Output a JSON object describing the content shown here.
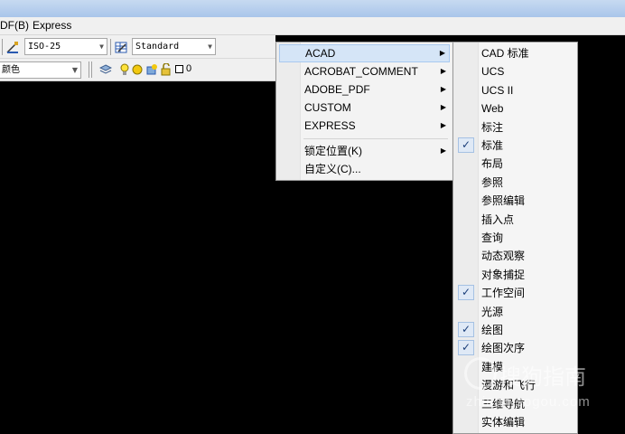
{
  "menubar": {
    "items": [
      "DF(B)",
      "Express"
    ]
  },
  "toolbar": {
    "dim_style": "ISO-25",
    "table_style": "Standard",
    "color_combo": "颜色",
    "layer_name": "0"
  },
  "menu1": {
    "items": [
      {
        "label": "ACAD",
        "submenu": true,
        "highlighted": true
      },
      {
        "label": "ACROBAT_COMMENT",
        "submenu": true
      },
      {
        "label": "ADOBE_PDF",
        "submenu": true
      },
      {
        "label": "CUSTOM",
        "submenu": true
      },
      {
        "label": "EXPRESS",
        "submenu": true
      },
      {
        "label": "锁定位置(K)",
        "submenu": true
      },
      {
        "label": "自定义(C)...",
        "submenu": false
      }
    ]
  },
  "menu2": {
    "items": [
      {
        "label": "CAD 标准",
        "checked": false
      },
      {
        "label": "UCS",
        "checked": false
      },
      {
        "label": "UCS II",
        "checked": false
      },
      {
        "label": "Web",
        "checked": false
      },
      {
        "label": "标注",
        "checked": false
      },
      {
        "label": "标准",
        "checked": true
      },
      {
        "label": "布局",
        "checked": false
      },
      {
        "label": "参照",
        "checked": false
      },
      {
        "label": "参照编辑",
        "checked": false
      },
      {
        "label": "插入点",
        "checked": false
      },
      {
        "label": "查询",
        "checked": false
      },
      {
        "label": "动态观察",
        "checked": false
      },
      {
        "label": "对象捕捉",
        "checked": false
      },
      {
        "label": "工作空间",
        "checked": true
      },
      {
        "label": "光源",
        "checked": false
      },
      {
        "label": "绘图",
        "checked": true
      },
      {
        "label": "绘图次序",
        "checked": true
      },
      {
        "label": "建模",
        "checked": false
      },
      {
        "label": "漫游和飞行",
        "checked": false
      },
      {
        "label": "三维导航",
        "checked": false
      },
      {
        "label": "实体编辑",
        "checked": false
      }
    ]
  },
  "glyphs": {
    "submenu_arrow": "▶",
    "check": "✓",
    "dropdown_arrow": "▼"
  },
  "watermark": {
    "main": "搜狗指南",
    "sub": "zhinan.sogou.com"
  }
}
